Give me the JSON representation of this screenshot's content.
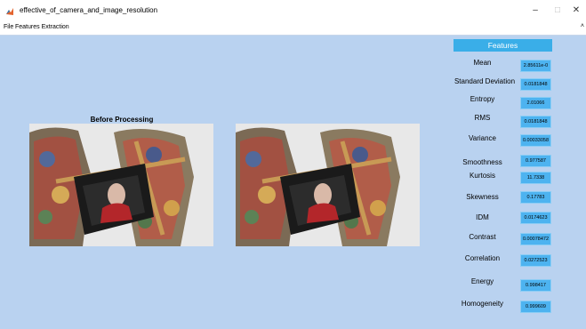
{
  "window": {
    "title": "effective_of_camera_and_image_resolution",
    "minimize_glyph": "–",
    "maximize_glyph": "□",
    "close_glyph": "✕"
  },
  "menu": {
    "file": "File",
    "features_extraction": "Features Extraction",
    "overflow_arrow": "˄"
  },
  "axes": {
    "before_title": "Before Processing"
  },
  "features": {
    "header": "Features",
    "items": [
      {
        "label": "Mean",
        "value": "2.85611e-0"
      },
      {
        "label": "Standard Deviation",
        "value": "0.0181848"
      },
      {
        "label": "Entropy",
        "value": "2.01066"
      },
      {
        "label": "RMS",
        "value": "0.0181848"
      },
      {
        "label": "Variance",
        "value": "0.00033058"
      },
      {
        "label": "Smoothness",
        "value": "0.977587"
      },
      {
        "label": "Kurtosis",
        "value": "11.7338"
      },
      {
        "label": "Skewness",
        "value": "0.17783"
      },
      {
        "label": "IDM",
        "value": "0.0174623"
      },
      {
        "label": "Contrast",
        "value": "0.00078472"
      },
      {
        "label": "Correlation",
        "value": "0.0272523"
      },
      {
        "label": "Energy",
        "value": "0.998417"
      },
      {
        "label": "Homogeneity",
        "value": "0.999609"
      }
    ]
  },
  "colors": {
    "figure_background": "#b9d2f0",
    "header_background": "#3aaee8",
    "value_box": "#4db3f0"
  }
}
